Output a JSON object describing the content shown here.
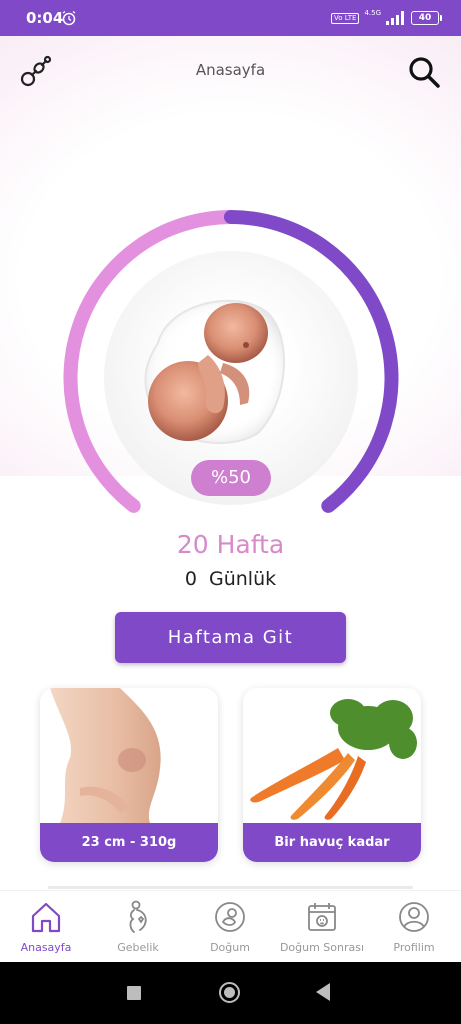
{
  "status_bar": {
    "time": "0:04",
    "network": "4.5G",
    "volte": "Vo LTE",
    "battery": "40"
  },
  "header": {
    "title": "Anasayfa",
    "left_icon": "pacifier-icon",
    "right_icon": "search-icon"
  },
  "progress": {
    "percent": 50,
    "percent_label": "%50",
    "week_label": "20 Hafta",
    "days_label": "0 Günlük"
  },
  "go_button": {
    "label": "Haftama Git"
  },
  "cards": [
    {
      "caption": "23 cm - 310g",
      "icon": "pregnant-belly-image"
    },
    {
      "caption": "Bir havuç kadar",
      "icon": "carrot-image"
    }
  ],
  "bottom_nav": {
    "items": [
      {
        "label": "Anasayfa",
        "icon": "home-icon",
        "active": true
      },
      {
        "label": "Gebelik",
        "icon": "pregnancy-icon",
        "active": false
      },
      {
        "label": "Doğum",
        "icon": "birth-icon",
        "active": false
      },
      {
        "label": "Doğum Sonrası",
        "icon": "calendar-baby-icon",
        "active": false
      },
      {
        "label": "Profilim",
        "icon": "profile-icon",
        "active": false
      }
    ]
  },
  "colors": {
    "primary": "#7f49c8",
    "accent_pink": "#d889c8",
    "ring_light": "#e79be0",
    "ring_dark": "#7f49c8"
  }
}
